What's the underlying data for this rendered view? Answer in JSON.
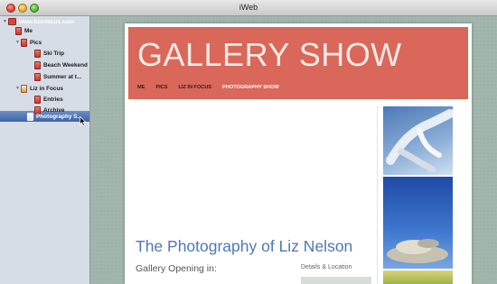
{
  "window": {
    "title": "iWeb"
  },
  "sidebar": {
    "site": "www.lizinfocus.com",
    "items": [
      {
        "label": "Me"
      },
      {
        "label": "Pics"
      },
      {
        "label": "Ski Trip"
      },
      {
        "label": "Beach Weekend"
      },
      {
        "label": "Summer at t..."
      },
      {
        "label": "Liz in Focus"
      },
      {
        "label": "Entries"
      },
      {
        "label": "Archive"
      },
      {
        "label": "Photography S..."
      }
    ],
    "selected": "Photography S..."
  },
  "page": {
    "site_title": "GALLERY SHOW",
    "nav": [
      "ME",
      "PICS",
      "LIZ IN FOCUS",
      "PHOTOGRAPHY SHOW"
    ],
    "nav_active": "PHOTOGRAPHY SHOW",
    "heading": "The Photography of Liz Nelson",
    "subheading": "Gallery Opening in:",
    "details_label": "Details & Location"
  },
  "colors": {
    "header": "#d9675a",
    "heading_text": "#4f77b7",
    "selection": "#3d62a6",
    "canvas": "#9fb4aa"
  }
}
